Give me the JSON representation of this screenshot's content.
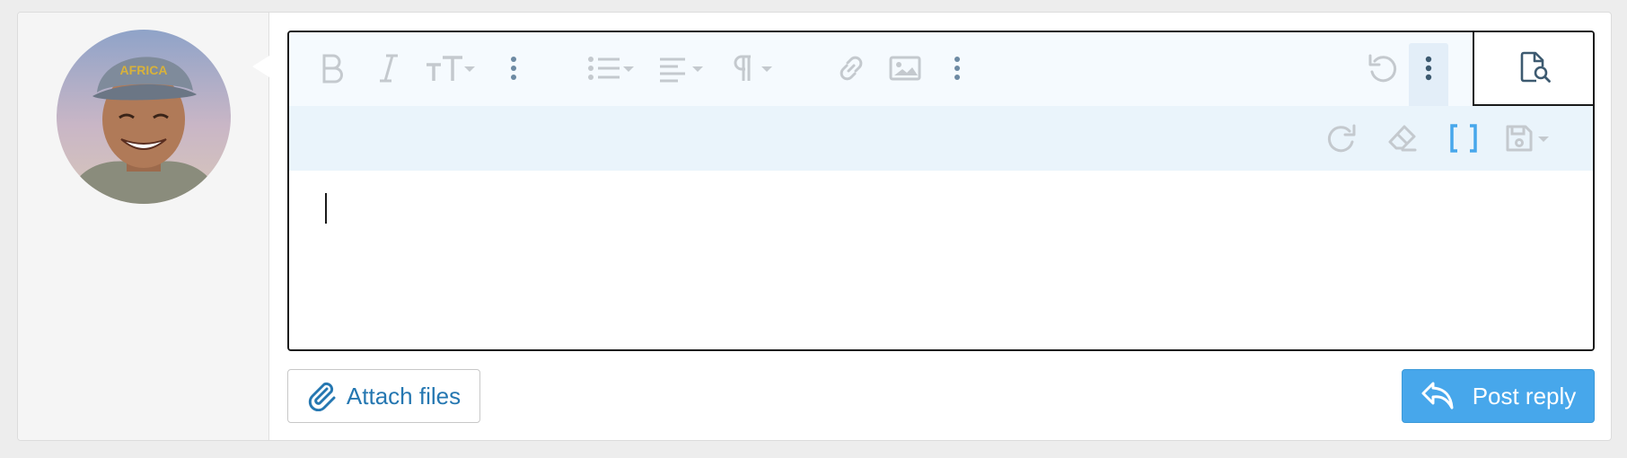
{
  "editor": {
    "toolbar_primary": [
      {
        "icon": "bold-icon"
      },
      {
        "icon": "italic-icon"
      },
      {
        "icon": "text-size-icon"
      },
      {
        "icon": "more-text-options-icon"
      },
      {
        "icon": "list-icon"
      },
      {
        "icon": "align-icon"
      },
      {
        "icon": "paragraph-icon"
      },
      {
        "icon": "link-icon"
      },
      {
        "icon": "image-icon"
      },
      {
        "icon": "more-insert-options-icon"
      },
      {
        "icon": "undo-icon"
      },
      {
        "icon": "more-misc-options-icon"
      },
      {
        "icon": "preview-icon"
      }
    ],
    "toolbar_secondary": [
      {
        "icon": "redo-icon"
      },
      {
        "icon": "clear-formatting-icon"
      },
      {
        "icon": "bbcode-toggle-icon"
      },
      {
        "icon": "drafts-icon"
      }
    ],
    "content": ""
  },
  "actions": {
    "attach_label": "Attach files",
    "post_label": "Post reply"
  },
  "colors": {
    "accent": "#47a7eb",
    "link": "#2577b1",
    "toolbar_bg": "#f5fafe",
    "toolbar2_bg": "#eaf4fb",
    "icon_muted": "#c4c9ce",
    "icon_dark": "#3d5a70"
  }
}
